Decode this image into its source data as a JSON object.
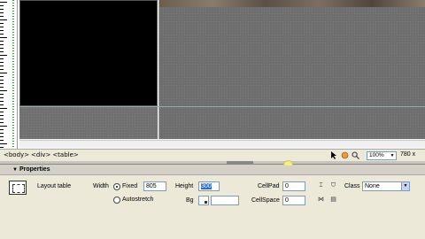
{
  "status_bar": {
    "tags": [
      "<body>",
      "<div>",
      "<table>"
    ],
    "zoom": "100%",
    "window_size": "780 x"
  },
  "properties": {
    "title": "Properties",
    "element_label": "Layout table",
    "width_label": "Width",
    "fixed_label": "Fixed",
    "fixed_value": "805",
    "autostretch_label": "Autostretch",
    "height_label": "Height",
    "height_value": "300",
    "bg_label": "Bg",
    "cellpad_label": "CellPad",
    "cellpad_value": "0",
    "cellspace_label": "CellSpace",
    "cellspace_value": "0",
    "class_label": "Class",
    "class_value": "None",
    "width_mode": "Fixed"
  },
  "icons": {
    "select": "arrow-pointer-icon",
    "hand": "hand-icon",
    "zoom": "magnifier-icon"
  },
  "colors": {
    "selection": "#316ac5",
    "panel_bg": "#ece9d8"
  }
}
